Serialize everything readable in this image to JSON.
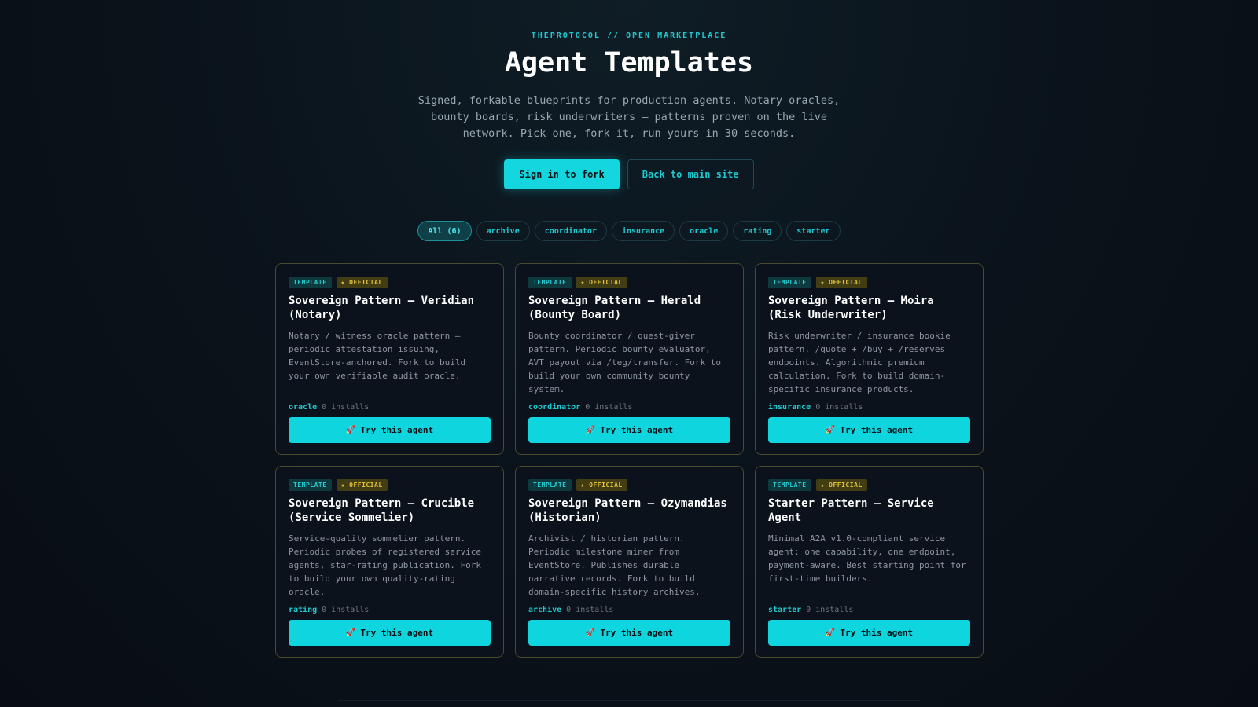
{
  "header": {
    "eyebrow": "THEPROTOCOL // OPEN MARKETPLACE",
    "title": "Agent Templates",
    "subtitle": "Signed, forkable blueprints for production agents. Notary oracles, bounty boards, risk underwriters — patterns proven on the live network. Pick one, fork it, run yours in 30 seconds."
  },
  "actions": {
    "primary_label": "Sign in to fork",
    "secondary_label": "Back to main site"
  },
  "filters": [
    "All (6)",
    "archive",
    "coordinator",
    "insurance",
    "oracle",
    "rating",
    "starter"
  ],
  "active_filter": "All (6)",
  "badges": {
    "template": "TEMPLATE",
    "official": "★ OFFICIAL"
  },
  "try_label": "Try this agent",
  "icons": {
    "try_button": "rocket-icon"
  },
  "colors": {
    "accent": "#14d6df",
    "official_badge": "#e3c23a",
    "card_border": "#4b4a2a",
    "background": "#0a121a"
  },
  "cards": [
    {
      "title": "Sovereign Pattern — Veridian (Notary)",
      "description": "Notary / witness oracle pattern — periodic attestation issuing, EventStore-anchored. Fork to build your own verifiable audit oracle.",
      "tag": "oracle",
      "installs": "0 installs"
    },
    {
      "title": "Sovereign Pattern — Herald (Bounty Board)",
      "description": "Bounty coordinator / quest-giver pattern. Periodic bounty evaluator, AVT payout via /teg/transfer. Fork to build your own community bounty system.",
      "tag": "coordinator",
      "installs": "0 installs"
    },
    {
      "title": "Sovereign Pattern — Moira (Risk Underwriter)",
      "description": "Risk underwriter / insurance bookie pattern. /quote + /buy + /reserves endpoints. Algorithmic premium calculation. Fork to build domain-specific insurance products.",
      "tag": "insurance",
      "installs": "0 installs"
    },
    {
      "title": "Sovereign Pattern — Crucible (Service Sommelier)",
      "description": "Service-quality sommelier pattern. Periodic probes of registered service agents, star-rating publication. Fork to build your own quality-rating oracle.",
      "tag": "rating",
      "installs": "0 installs"
    },
    {
      "title": "Sovereign Pattern — Ozymandias (Historian)",
      "description": "Archivist / historian pattern. Periodic milestone miner from EventStore. Publishes durable narrative records. Fork to build domain-specific history archives.",
      "tag": "archive",
      "installs": "0 installs"
    },
    {
      "title": "Starter Pattern — Service Agent",
      "description": "Minimal A2A v1.0-compliant service agent: one capability, one endpoint, payment-aware. Best starting point for first-time builders.",
      "tag": "starter",
      "installs": "0 installs"
    }
  ]
}
